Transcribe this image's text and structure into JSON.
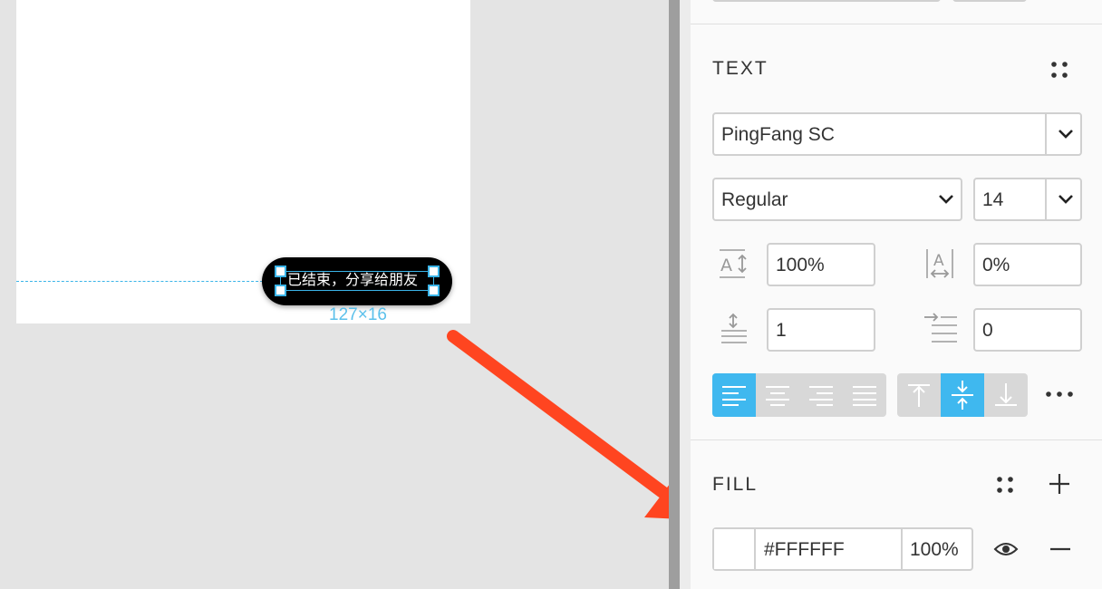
{
  "canvas": {
    "toast_text": "已结束，分享给朋友",
    "dimensions_label": "127×16"
  },
  "inspector": {
    "text_section": {
      "title": "TEXT",
      "font_family": "PingFang SC",
      "font_weight": "Regular",
      "font_size": "14",
      "line_height": "100%",
      "letter_spacing": "0%",
      "paragraph_spacing": "1",
      "indent": "0",
      "horizontal_alignment_active": "left",
      "vertical_alignment_active": "middle"
    },
    "fill_section": {
      "title": "FILL",
      "color_hex": "#FFFFFF",
      "opacity": "100%",
      "swatch_color": "#FFFFFF"
    }
  },
  "colors": {
    "accent": "#3FB8EF",
    "annotation_arrow": "#FF4520"
  }
}
